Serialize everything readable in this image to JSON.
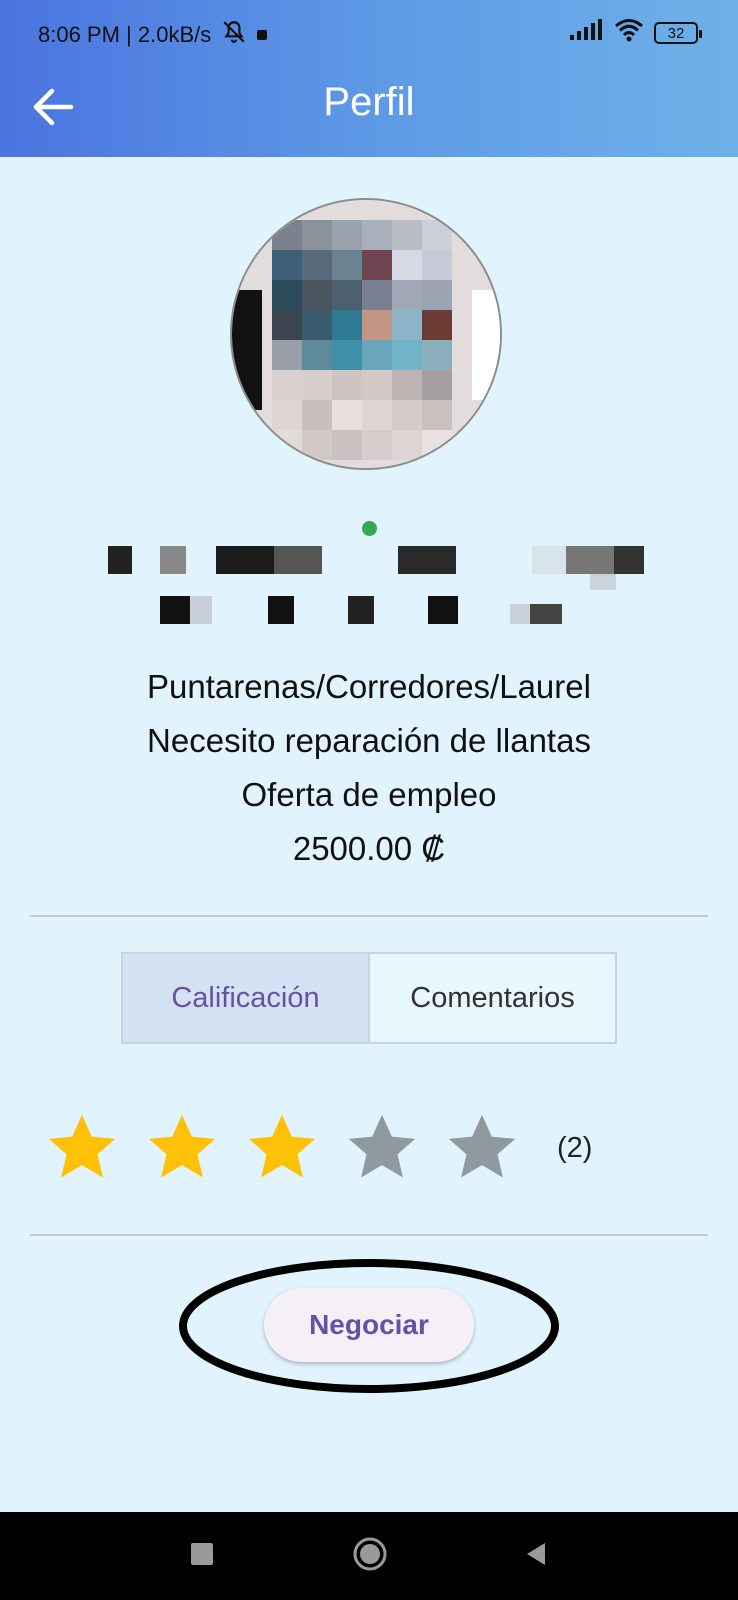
{
  "status_bar": {
    "time_speed": "8:06 PM | 2.0kB/s",
    "battery": "32"
  },
  "app_bar": {
    "title": "Perfil"
  },
  "profile": {
    "location": "Puntarenas/Corredores/Laurel",
    "description": "Necesito reparación de llantas",
    "category": "Oferta de empleo",
    "price": "2500.00 ₡",
    "online": true
  },
  "tabs": [
    {
      "label": "Calificación",
      "active": true
    },
    {
      "label": "Comentarios",
      "active": false
    }
  ],
  "rating": {
    "stars_filled": 3,
    "stars_total": 5,
    "count": "(2)",
    "filled_color": "#FFC107",
    "empty_color": "#8E9A9D"
  },
  "actions": {
    "negociar_label": "Negociar"
  },
  "colors": {
    "accent": "#6651A7",
    "background": "#E1F4FD",
    "header_start": "#4A74DF",
    "header_end": "#6FB0E8"
  }
}
